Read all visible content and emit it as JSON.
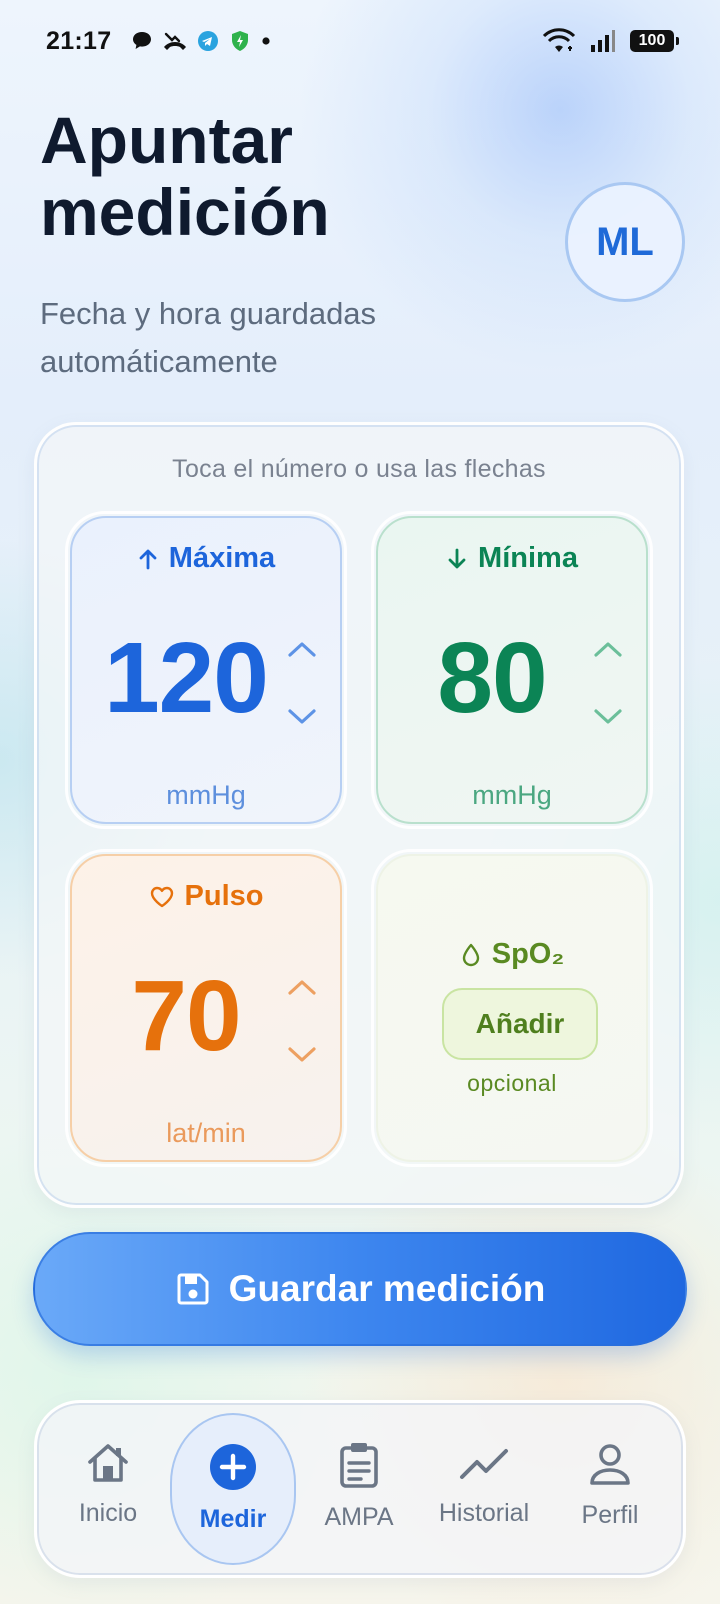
{
  "status_bar": {
    "time": "21:17",
    "battery": "100",
    "icons": [
      "chat-bubble-icon",
      "missed-call-icon",
      "telegram-icon",
      "shield-icon",
      "dot-icon",
      "wifi-icon",
      "signal-icon",
      "battery-icon"
    ]
  },
  "header": {
    "title": "Apuntar medición",
    "subtitle": "Fecha y hora guardadas automáticamente",
    "avatar_initials": "ML"
  },
  "card": {
    "hint": "Toca el número o usa las flechas",
    "systolic": {
      "label": "Máxima",
      "value": "120",
      "unit": "mmHg",
      "color": "#1d65db"
    },
    "diastolic": {
      "label": "Mínima",
      "value": "80",
      "unit": "mmHg",
      "color": "#0b8455"
    },
    "pulse": {
      "label": "Pulso",
      "value": "70",
      "unit": "lat/min",
      "color": "#e6710c"
    },
    "spo2": {
      "label": "SpO₂",
      "button": "Añadir",
      "note": "opcional",
      "color": "#5a8a22"
    }
  },
  "save_button": {
    "label": "Guardar medición"
  },
  "nav": {
    "items": [
      {
        "label": "Inicio",
        "icon": "home-icon",
        "active": false
      },
      {
        "label": "Medir",
        "icon": "plus-circle-icon",
        "active": true
      },
      {
        "label": "AMPA",
        "icon": "clipboard-icon",
        "active": false
      },
      {
        "label": "Historial",
        "icon": "trend-line-icon",
        "active": false
      },
      {
        "label": "Perfil",
        "icon": "user-icon",
        "active": false
      }
    ]
  }
}
